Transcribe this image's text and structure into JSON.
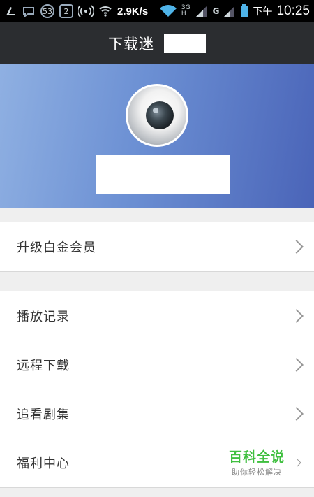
{
  "status_bar": {
    "badge_count": "53",
    "box_count": "2",
    "net_speed": "2.9K/s",
    "net_type_top": "3G",
    "net_type_bottom": "H",
    "signal_label": "G",
    "ampm": "下午",
    "time": "10:25"
  },
  "header": {
    "title": "下载迷"
  },
  "menu_groups": [
    {
      "items": [
        {
          "label": "升级白金会员"
        }
      ]
    },
    {
      "items": [
        {
          "label": "播放记录"
        },
        {
          "label": "远程下载"
        },
        {
          "label": "追看剧集"
        },
        {
          "label": "福利中心"
        }
      ]
    }
  ],
  "watermark": {
    "title": "百科全说",
    "subtitle": "助你轻松解决"
  },
  "colors": {
    "title_bar": "#2b2d30",
    "hero_gradient_start": "#8fb0e2",
    "hero_gradient_end": "#4a64b8",
    "watermark_green": "#3fbf3f"
  }
}
